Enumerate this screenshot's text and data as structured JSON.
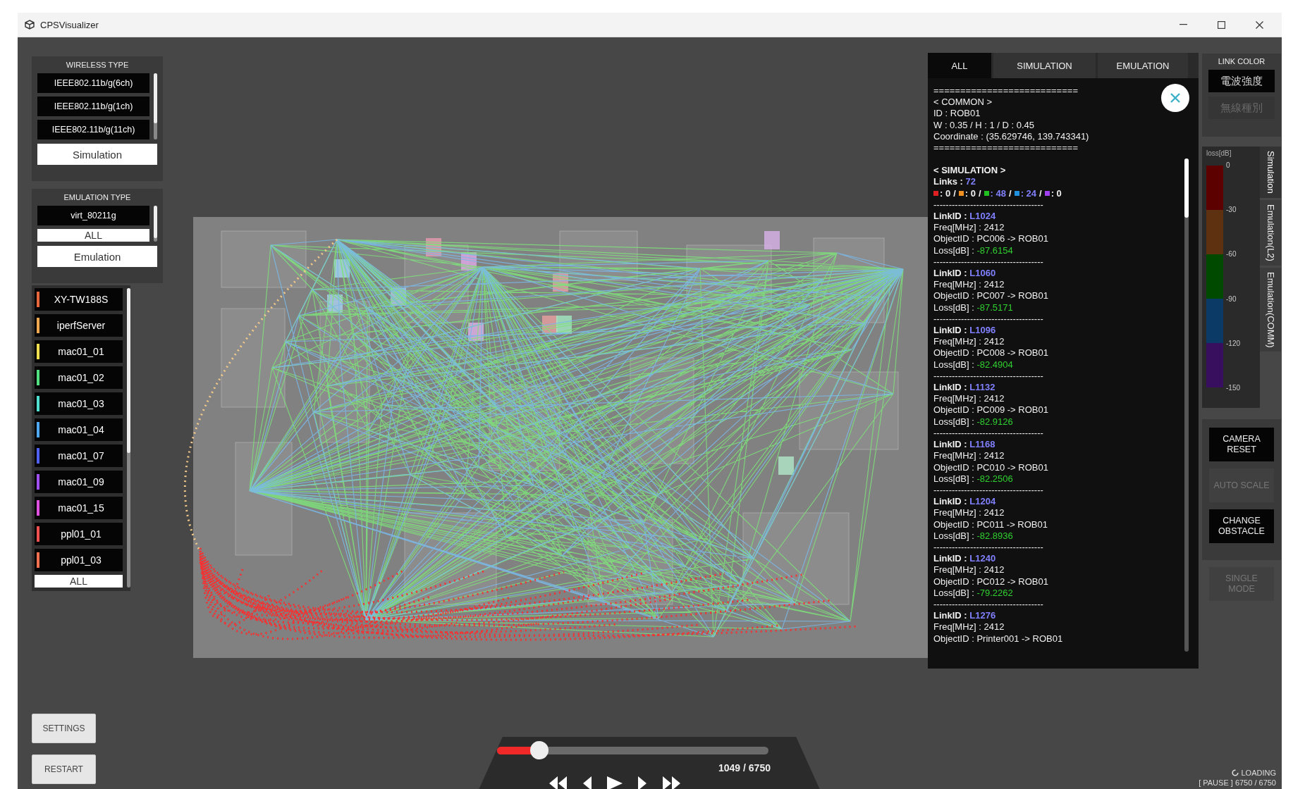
{
  "window": {
    "title": "CPSVisualizer"
  },
  "wireless_type": {
    "title": "WIRELESS TYPE",
    "items": [
      "IEEE802.11b/g(6ch)",
      "IEEE802.11b/g(1ch)",
      "IEEE802.11b/g(11ch)"
    ],
    "button": "Simulation"
  },
  "emulation_type": {
    "title": "EMULATION TYPE",
    "items": [
      "virt_80211g"
    ],
    "all_button": "ALL",
    "button": "Emulation"
  },
  "objects": {
    "items": [
      {
        "name": "XY-TW188S",
        "color": "#e8663c"
      },
      {
        "name": "iperfServer",
        "color": "#f0a850"
      },
      {
        "name": "mac01_01",
        "color": "#f0e050"
      },
      {
        "name": "mac01_02",
        "color": "#50e080"
      },
      {
        "name": "mac01_03",
        "color": "#50e0d0"
      },
      {
        "name": "mac01_04",
        "color": "#50a8f0"
      },
      {
        "name": "mac01_07",
        "color": "#5060f0"
      },
      {
        "name": "mac01_09",
        "color": "#a050f0"
      },
      {
        "name": "mac01_15",
        "color": "#e050e0"
      },
      {
        "name": "ppl01_01",
        "color": "#f05050"
      },
      {
        "name": "ppl01_03",
        "color": "#f07050"
      }
    ],
    "all_button": "ALL"
  },
  "settings_button": "SETTINGS",
  "restart_button": "RESTART",
  "info_panel": {
    "tabs": [
      {
        "label": "ALL",
        "selected": true
      },
      {
        "label": "SIMULATION",
        "selected": false
      },
      {
        "label": "EMULATION",
        "selected": false
      }
    ],
    "common": {
      "rule_top": "===========================",
      "heading": "< COMMON >",
      "lines": [
        "ID : ROB01",
        "W : 0.35  /  H : 1  /  D : 0.45",
        "Coordinate : (35.629746, 139.743341)"
      ],
      "rule_bottom": "==========================="
    },
    "simulation": {
      "heading": "< SIMULATION >",
      "links_label": "Links :",
      "links_count": "72",
      "counts": [
        {
          "color": "#e02020",
          "count": ": 0",
          "highlighted": false
        },
        {
          "separator": "/",
          "color": "#f09020",
          "count": ": 0",
          "highlighted": false
        },
        {
          "separator": "/",
          "color": "#20c020",
          "count": ": 48",
          "highlighted": true
        },
        {
          "separator": "/",
          "color": "#2090e0",
          "count": ": 24",
          "highlighted": true
        },
        {
          "separator": "/",
          "color": "#a040f0",
          "count": ": 0",
          "highlighted": false
        }
      ]
    },
    "links": [
      {
        "divider": "------------------------------------",
        "id_label": "LinkID :",
        "id": "L1024",
        "freq_label": "Freq[MHz] :",
        "freq": "2412",
        "object_label": "ObjectID :",
        "object": "PC006 -> ROB01",
        "loss_label": "Loss[dB] :",
        "loss": "-87.6154"
      },
      {
        "divider": "------------------------------------",
        "id_label": "LinkID :",
        "id": "L1060",
        "freq_label": "Freq[MHz] :",
        "freq": "2412",
        "object_label": "ObjectID :",
        "object": "PC007 -> ROB01",
        "loss_label": "Loss[dB] :",
        "loss": "-87.5171"
      },
      {
        "divider": "------------------------------------",
        "id_label": "LinkID :",
        "id": "L1096",
        "freq_label": "Freq[MHz] :",
        "freq": "2412",
        "object_label": "ObjectID :",
        "object": "PC008 -> ROB01",
        "loss_label": "Loss[dB] :",
        "loss": "-82.4904"
      },
      {
        "divider": "------------------------------------",
        "id_label": "LinkID :",
        "id": "L1132",
        "freq_label": "Freq[MHz] :",
        "freq": "2412",
        "object_label": "ObjectID :",
        "object": "PC009 -> ROB01",
        "loss_label": "Loss[dB] :",
        "loss": "-82.9126"
      },
      {
        "divider": "------------------------------------",
        "id_label": "LinkID :",
        "id": "L1168",
        "freq_label": "Freq[MHz] :",
        "freq": "2412",
        "object_label": "ObjectID :",
        "object": "PC010 -> ROB01",
        "loss_label": "Loss[dB] :",
        "loss": "-82.2506"
      },
      {
        "divider": "------------------------------------",
        "id_label": "LinkID :",
        "id": "L1204",
        "freq_label": "Freq[MHz] :",
        "freq": "2412",
        "object_label": "ObjectID :",
        "object": "PC011 -> ROB01",
        "loss_label": "Loss[dB] :",
        "loss": "-82.8936"
      },
      {
        "divider": "------------------------------------",
        "id_label": "LinkID :",
        "id": "L1240",
        "freq_label": "Freq[MHz] :",
        "freq": "2412",
        "object_label": "ObjectID :",
        "object": "PC012 -> ROB01",
        "loss_label": "Loss[dB] :",
        "loss": "-79.2262"
      },
      {
        "divider": "------------------------------------",
        "id_label": "LinkID :",
        "id": "L1276",
        "freq_label": "Freq[MHz] :",
        "freq": "2412",
        "object_label": "ObjectID :",
        "object": "Printer001 -> ROB01"
      }
    ]
  },
  "link_color": {
    "title": "LINK COLOR",
    "options": [
      {
        "label": "電波強度",
        "selected": true
      },
      {
        "label": "無線種別",
        "selected": false
      }
    ]
  },
  "legend": {
    "title": "loss[dB]",
    "segments": [
      {
        "color": "#5c0000"
      },
      {
        "color": "#5e3210"
      },
      {
        "color": "#004a00"
      },
      {
        "color": "#0c3a66"
      },
      {
        "color": "#380f5e"
      }
    ],
    "ticks": [
      "0",
      "-30",
      "-60",
      "-90",
      "-120",
      "-150"
    ]
  },
  "view_tabs": [
    {
      "label": "Simulation",
      "selected": true
    },
    {
      "label": "Emulation(L2)",
      "selected": false
    },
    {
      "label": "Emulation(COMM)",
      "selected": false
    }
  ],
  "camera_buttons": [
    {
      "label": "CAMERA RESET",
      "active": true
    },
    {
      "label": "AUTO SCALE",
      "active": false
    },
    {
      "label": "CHANGE OBSTACLE",
      "active": true
    }
  ],
  "single_mode_button": {
    "label": "SINGLE MODE",
    "active": false
  },
  "playback": {
    "level": 0.155,
    "counter": "1049 / 6750"
  },
  "status": {
    "loading": "LOADING",
    "state": "[ PAUSE ] 6750 / 6750"
  }
}
